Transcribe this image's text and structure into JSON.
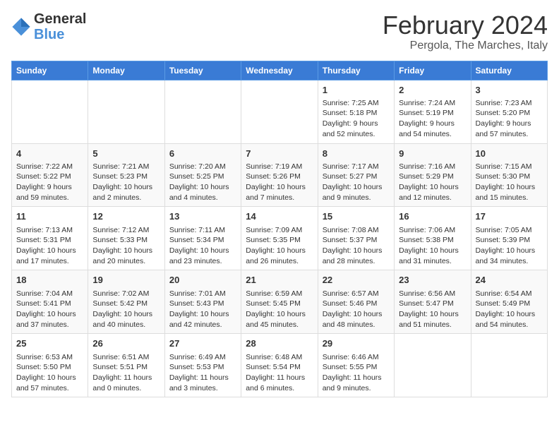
{
  "header": {
    "logo_text_general": "General",
    "logo_text_blue": "Blue",
    "month_title": "February 2024",
    "location": "Pergola, The Marches, Italy"
  },
  "calendar": {
    "days_of_week": [
      "Sunday",
      "Monday",
      "Tuesday",
      "Wednesday",
      "Thursday",
      "Friday",
      "Saturday"
    ],
    "weeks": [
      [
        {
          "num": "",
          "detail": ""
        },
        {
          "num": "",
          "detail": ""
        },
        {
          "num": "",
          "detail": ""
        },
        {
          "num": "",
          "detail": ""
        },
        {
          "num": "1",
          "detail": "Sunrise: 7:25 AM\nSunset: 5:18 PM\nDaylight: 9 hours and 52 minutes."
        },
        {
          "num": "2",
          "detail": "Sunrise: 7:24 AM\nSunset: 5:19 PM\nDaylight: 9 hours and 54 minutes."
        },
        {
          "num": "3",
          "detail": "Sunrise: 7:23 AM\nSunset: 5:20 PM\nDaylight: 9 hours and 57 minutes."
        }
      ],
      [
        {
          "num": "4",
          "detail": "Sunrise: 7:22 AM\nSunset: 5:22 PM\nDaylight: 9 hours and 59 minutes."
        },
        {
          "num": "5",
          "detail": "Sunrise: 7:21 AM\nSunset: 5:23 PM\nDaylight: 10 hours and 2 minutes."
        },
        {
          "num": "6",
          "detail": "Sunrise: 7:20 AM\nSunset: 5:25 PM\nDaylight: 10 hours and 4 minutes."
        },
        {
          "num": "7",
          "detail": "Sunrise: 7:19 AM\nSunset: 5:26 PM\nDaylight: 10 hours and 7 minutes."
        },
        {
          "num": "8",
          "detail": "Sunrise: 7:17 AM\nSunset: 5:27 PM\nDaylight: 10 hours and 9 minutes."
        },
        {
          "num": "9",
          "detail": "Sunrise: 7:16 AM\nSunset: 5:29 PM\nDaylight: 10 hours and 12 minutes."
        },
        {
          "num": "10",
          "detail": "Sunrise: 7:15 AM\nSunset: 5:30 PM\nDaylight: 10 hours and 15 minutes."
        }
      ],
      [
        {
          "num": "11",
          "detail": "Sunrise: 7:13 AM\nSunset: 5:31 PM\nDaylight: 10 hours and 17 minutes."
        },
        {
          "num": "12",
          "detail": "Sunrise: 7:12 AM\nSunset: 5:33 PM\nDaylight: 10 hours and 20 minutes."
        },
        {
          "num": "13",
          "detail": "Sunrise: 7:11 AM\nSunset: 5:34 PM\nDaylight: 10 hours and 23 minutes."
        },
        {
          "num": "14",
          "detail": "Sunrise: 7:09 AM\nSunset: 5:35 PM\nDaylight: 10 hours and 26 minutes."
        },
        {
          "num": "15",
          "detail": "Sunrise: 7:08 AM\nSunset: 5:37 PM\nDaylight: 10 hours and 28 minutes."
        },
        {
          "num": "16",
          "detail": "Sunrise: 7:06 AM\nSunset: 5:38 PM\nDaylight: 10 hours and 31 minutes."
        },
        {
          "num": "17",
          "detail": "Sunrise: 7:05 AM\nSunset: 5:39 PM\nDaylight: 10 hours and 34 minutes."
        }
      ],
      [
        {
          "num": "18",
          "detail": "Sunrise: 7:04 AM\nSunset: 5:41 PM\nDaylight: 10 hours and 37 minutes."
        },
        {
          "num": "19",
          "detail": "Sunrise: 7:02 AM\nSunset: 5:42 PM\nDaylight: 10 hours and 40 minutes."
        },
        {
          "num": "20",
          "detail": "Sunrise: 7:01 AM\nSunset: 5:43 PM\nDaylight: 10 hours and 42 minutes."
        },
        {
          "num": "21",
          "detail": "Sunrise: 6:59 AM\nSunset: 5:45 PM\nDaylight: 10 hours and 45 minutes."
        },
        {
          "num": "22",
          "detail": "Sunrise: 6:57 AM\nSunset: 5:46 PM\nDaylight: 10 hours and 48 minutes."
        },
        {
          "num": "23",
          "detail": "Sunrise: 6:56 AM\nSunset: 5:47 PM\nDaylight: 10 hours and 51 minutes."
        },
        {
          "num": "24",
          "detail": "Sunrise: 6:54 AM\nSunset: 5:49 PM\nDaylight: 10 hours and 54 minutes."
        }
      ],
      [
        {
          "num": "25",
          "detail": "Sunrise: 6:53 AM\nSunset: 5:50 PM\nDaylight: 10 hours and 57 minutes."
        },
        {
          "num": "26",
          "detail": "Sunrise: 6:51 AM\nSunset: 5:51 PM\nDaylight: 11 hours and 0 minutes."
        },
        {
          "num": "27",
          "detail": "Sunrise: 6:49 AM\nSunset: 5:53 PM\nDaylight: 11 hours and 3 minutes."
        },
        {
          "num": "28",
          "detail": "Sunrise: 6:48 AM\nSunset: 5:54 PM\nDaylight: 11 hours and 6 minutes."
        },
        {
          "num": "29",
          "detail": "Sunrise: 6:46 AM\nSunset: 5:55 PM\nDaylight: 11 hours and 9 minutes."
        },
        {
          "num": "",
          "detail": ""
        },
        {
          "num": "",
          "detail": ""
        }
      ]
    ]
  }
}
